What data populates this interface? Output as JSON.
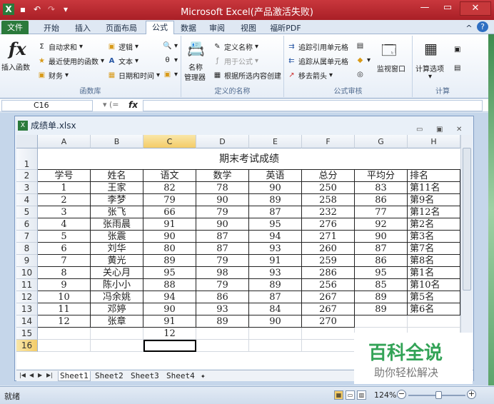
{
  "window": {
    "title": "Microsoft Excel(产品激活失败)"
  },
  "ribbon_tabs": [
    "文件",
    "开始",
    "插入",
    "页面布局",
    "公式",
    "数据",
    "审阅",
    "视图",
    "福昕PDF"
  ],
  "ribbon": {
    "insert_function": "插入函数",
    "autosum": "自动求和",
    "recent": "最近使用的函数",
    "finance": "财务",
    "logic": "逻辑",
    "text": "文本",
    "datetime": "日期和时间",
    "lib_label": "函数库",
    "name_manager_1": "名称",
    "name_manager_2": "管理器",
    "define_name": "定义名称",
    "use_in_formula": "用于公式",
    "create_from_sel": "根据所选内容创建",
    "names_label": "定义的名称",
    "trace_precedents": "追踪引用单元格",
    "trace_dependents": "追踪从属单元格",
    "remove_arrows": "移去箭头",
    "watch_window": "监视窗口",
    "audit_label": "公式审核",
    "calc_options": "计算选项",
    "calc_label": "计算"
  },
  "formula_bar": {
    "name_box": "C16",
    "fx": "fx",
    "content": ""
  },
  "workbook": {
    "title": "成绩单.xlsx"
  },
  "columns": [
    "A",
    "B",
    "C",
    "D",
    "E",
    "F",
    "G",
    "H"
  ],
  "rows": [
    "1",
    "2",
    "3",
    "4",
    "5",
    "6",
    "7",
    "8",
    "9",
    "10",
    "11",
    "12",
    "13",
    "14",
    "15",
    "16"
  ],
  "sheet_title": "期末考试成绩",
  "headers": [
    "学号",
    "姓名",
    "语文",
    "数学",
    "英语",
    "总分",
    "平均分",
    "排名"
  ],
  "records": [
    [
      "1",
      "王家",
      "82",
      "78",
      "90",
      "250",
      "83",
      "第11名"
    ],
    [
      "2",
      "李梦",
      "79",
      "90",
      "89",
      "258",
      "86",
      "第9名"
    ],
    [
      "3",
      "张飞",
      "66",
      "79",
      "87",
      "232",
      "77",
      "第12名"
    ],
    [
      "4",
      "张雨晨",
      "91",
      "90",
      "95",
      "276",
      "92",
      "第2名"
    ],
    [
      "5",
      "张震",
      "90",
      "87",
      "94",
      "271",
      "90",
      "第3名"
    ],
    [
      "6",
      "刘华",
      "80",
      "87",
      "93",
      "260",
      "87",
      "第7名"
    ],
    [
      "7",
      "黄光",
      "89",
      "79",
      "91",
      "259",
      "86",
      "第8名"
    ],
    [
      "8",
      "关心月",
      "95",
      "98",
      "93",
      "286",
      "95",
      "第1名"
    ],
    [
      "9",
      "陈小小",
      "88",
      "79",
      "89",
      "256",
      "85",
      "第10名"
    ],
    [
      "10",
      "冯余姚",
      "94",
      "86",
      "87",
      "267",
      "89",
      "第5名"
    ],
    [
      "11",
      "邓婷",
      "90",
      "93",
      "84",
      "267",
      "89",
      "第6名"
    ],
    [
      "12",
      "张章",
      "91",
      "89",
      "90",
      "270",
      "",
      ""
    ]
  ],
  "row15_c": "12",
  "sheets": [
    "Sheet1",
    "Sheet2",
    "Sheet3",
    "Sheet4"
  ],
  "status": {
    "ready": "就绪",
    "zoom": "124%"
  },
  "watermark": {
    "big": "百科全说",
    "small": "助你轻松解决"
  }
}
